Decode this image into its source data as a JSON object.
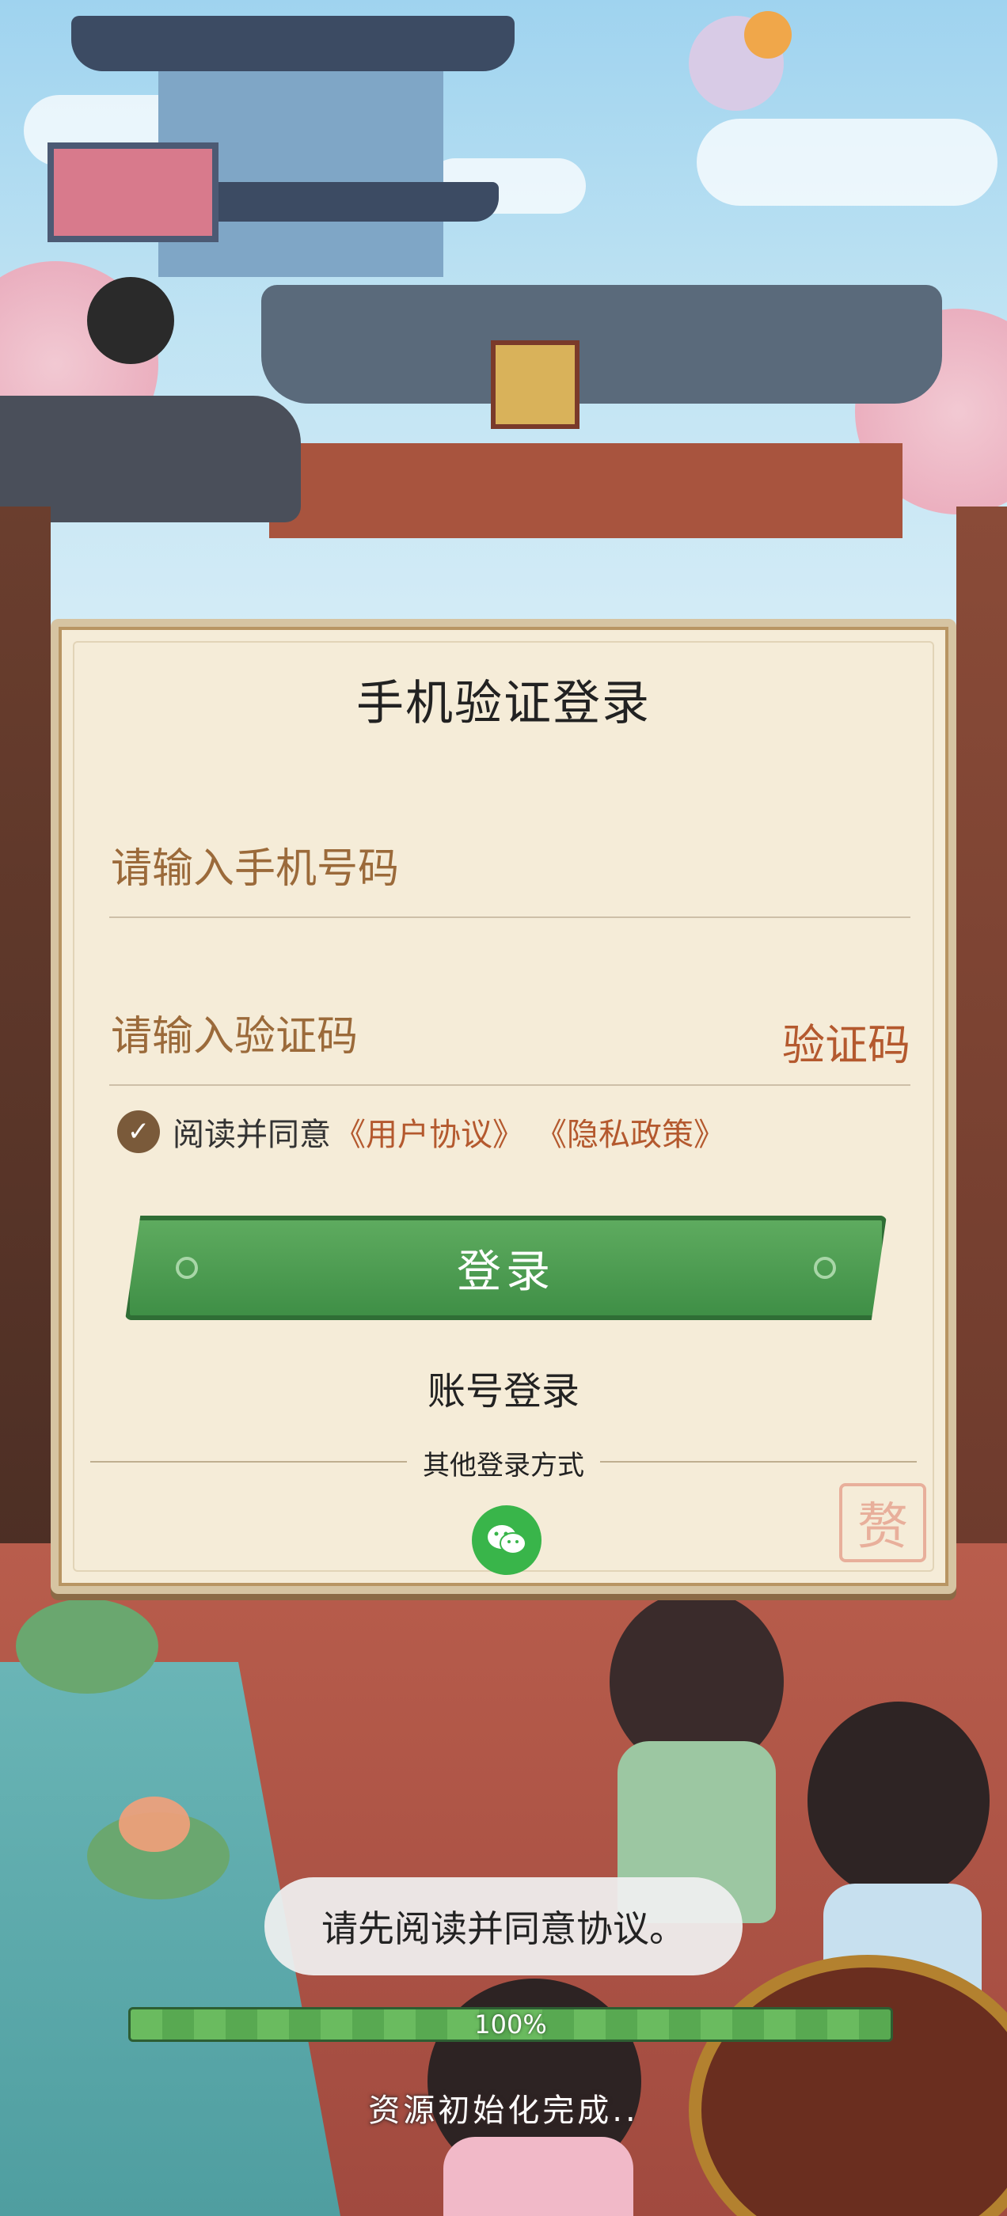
{
  "login": {
    "title": "手机验证登录",
    "phone_placeholder": "请输入手机号码",
    "code_placeholder": "请输入验证码",
    "get_code_label": "验证码",
    "agree_prefix": "阅读并同意",
    "user_agreement": "《用户协议》",
    "privacy_policy": "《隐私政策》",
    "login_button": "登录",
    "account_login": "账号登录",
    "other_methods": "其他登录方式",
    "seal_char": "赘"
  },
  "toast": {
    "message": "请先阅读并同意协议。"
  },
  "loading": {
    "progress": 100,
    "progress_label": "100%",
    "status": "资源初始化完成.."
  },
  "colors": {
    "accent": "#b4592e",
    "button_green": "#4a9a4f",
    "wechat_green": "#39b54a",
    "panel_bg": "#f5ecd8"
  },
  "icons": {
    "checkbox": "check-circle-icon",
    "wechat": "wechat-icon"
  }
}
